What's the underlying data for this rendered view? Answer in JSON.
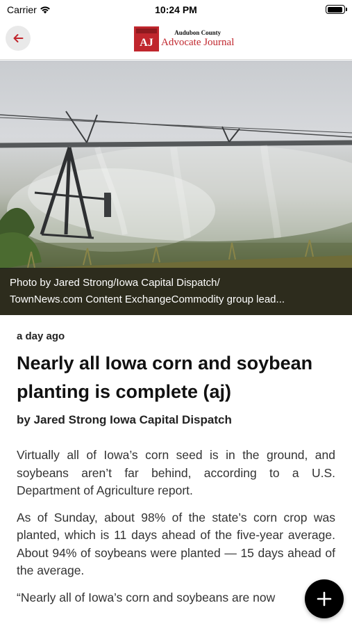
{
  "status_bar": {
    "carrier": "Carrier",
    "time": "10:24 PM",
    "icons": [
      "wifi-icon",
      "battery-icon"
    ]
  },
  "nav": {
    "back_icon": "arrow-left-icon",
    "logo": {
      "mark_text": "AJ",
      "line1": "Audubon County",
      "line2": "Advocate Journal"
    }
  },
  "hero": {
    "image": "irrigation-pivot-photo",
    "caption_line1": "Photo by Jared Strong/Iowa Capital Dispatch/",
    "caption_line2": "TownNews.com Content ExchangeCommodity group lead..."
  },
  "article": {
    "timestamp": "a day ago",
    "headline": "Nearly all Iowa corn and soybean planting is complete (aj)",
    "byline": "by Jared Strong Iowa Capital Dispatch",
    "paragraphs": [
      "Virtually all of Iowa’s corn seed is in the ground, and soybeans aren’t far behind, according to a U.S. Department of Agriculture report.",
      "As of Sunday, about 98% of the state’s corn crop was planted, which is 11 days ahead of the five-year average. About 94% of soybeans were planted — 15 days ahead of the average.",
      "“Nearly all of Iowa’s corn and soybeans are now"
    ]
  },
  "fab": {
    "icon": "plus-icon"
  },
  "colors": {
    "brand_red": "#c0262d",
    "back_button_bg": "#e9e9e9",
    "fab_bg": "#000000"
  }
}
